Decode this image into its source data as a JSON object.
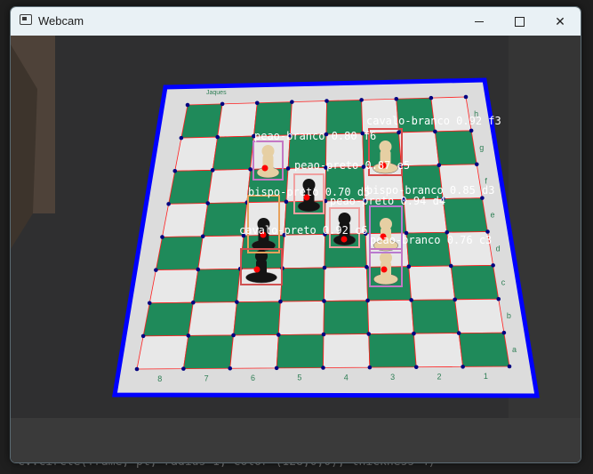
{
  "window": {
    "title": "Webcam"
  },
  "editor": {
    "bottom_code": "cv.circle(frame, pt, radius=1, color=(128,0,0), thickness=4)"
  },
  "board": {
    "brand": "Jaques",
    "file_labels": [
      "8",
      "7",
      "6",
      "5",
      "4",
      "3",
      "2",
      "1"
    ],
    "rank_labels": [
      "a",
      "b",
      "c",
      "d",
      "e",
      "f",
      "g",
      "h"
    ],
    "colors": {
      "border": "#0000ff",
      "grid_line": "#ff2020",
      "dark_square": "#1f8a5a",
      "light_square": "#e8e8e8",
      "corner_point": "#000080",
      "center_dot": "#ff0000"
    }
  },
  "detections": [
    {
      "label": "cavalo-branco 0.92 f3",
      "color": "#d84a4a"
    },
    {
      "label": "peao-branco 0.80 f6",
      "color": "#c477c4"
    },
    {
      "label": "peao-preto 0.87 e5",
      "color": "#f0a0a0"
    },
    {
      "label": "bispo-preto 0.70 d5",
      "color": "#e8a15a"
    },
    {
      "label": "bispo-branco 0.85 d3",
      "color": "#b87ad0"
    },
    {
      "label": "peao-preto 0.94 d4",
      "color": "#f0a0a0"
    },
    {
      "label": "cavalo-preto 0.92 c6",
      "color": "#d05050"
    },
    {
      "label": "peao-branco 0.76 c3",
      "color": "#c477c4"
    }
  ]
}
